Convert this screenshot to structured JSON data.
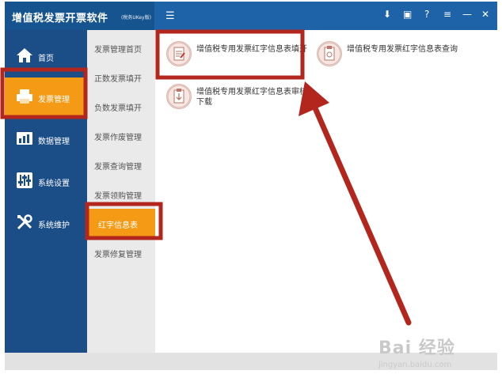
{
  "app": {
    "title": "增值税发票开票软件",
    "subtitle": "(税务UKey版)",
    "menu_toggle": "☰",
    "controls": [
      "⬇",
      "▣",
      "?",
      "≡",
      "—",
      "✕"
    ]
  },
  "main_nav": [
    {
      "label": "首页",
      "icon": "home-icon"
    },
    {
      "label": "发票管理",
      "icon": "invoice-printer-icon",
      "active": true
    },
    {
      "label": "数据管理",
      "icon": "data-management-icon"
    },
    {
      "label": "系统设置",
      "icon": "settings-sliders-icon"
    },
    {
      "label": "系统维护",
      "icon": "tools-icon"
    }
  ],
  "sub_nav": [
    {
      "label": "发票管理首页"
    },
    {
      "label": "正数发票填开"
    },
    {
      "label": "负数发票填开"
    },
    {
      "label": "发票作废管理"
    },
    {
      "label": "发票查询管理"
    },
    {
      "label": "发票领购管理"
    },
    {
      "label": "红字信息表",
      "active": true
    },
    {
      "label": "发票修复管理"
    }
  ],
  "functions": [
    {
      "label": "增值税专用发票红字信息表填开",
      "icon": "form-edit-icon"
    },
    {
      "label": "增值税专用发票红字信息表查询",
      "icon": "form-query-icon"
    },
    {
      "label": "增值税专用发票红字信息表审核下载",
      "icon": "form-download-icon"
    }
  ],
  "watermark": {
    "main": "Bai 经验",
    "sub": "jingyan.baidu.com"
  },
  "colors": {
    "title_bar": "#1e63a8",
    "sidebar": "#1b4d86",
    "active": "#f59a14",
    "annotation": "#b3261e"
  }
}
